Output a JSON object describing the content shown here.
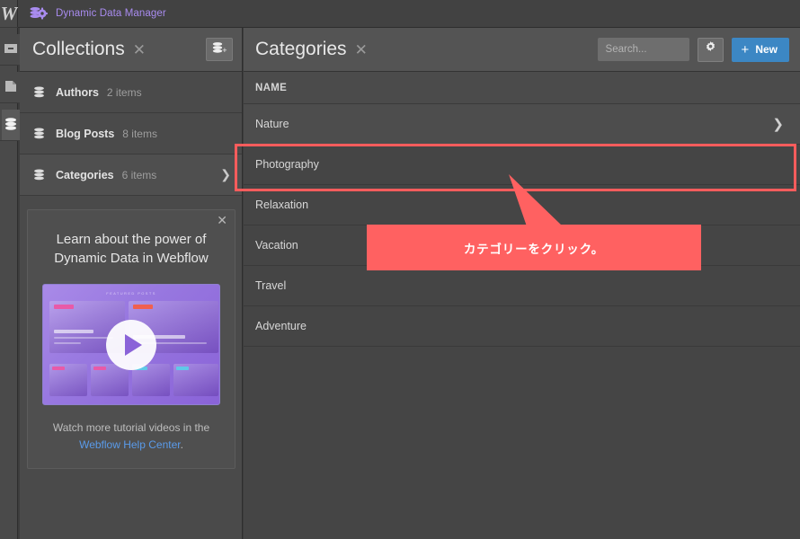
{
  "window": {
    "app_logo": "webflow-w-logo",
    "title": "Dynamic Data Manager",
    "title_icon": "database-gear-icon",
    "accent_purple": "#a98cf0",
    "accent_blue": "#3c87c4",
    "annotation_red": "#ff6161"
  },
  "left_rail": {
    "items": [
      {
        "icon": "add-element-icon"
      },
      {
        "icon": "pages-icon"
      },
      {
        "icon": "cms-database-icon",
        "active": true
      }
    ]
  },
  "collections_panel": {
    "title": "Collections",
    "close_icon": "close-icon",
    "add_button_icon": "add-collection-icon",
    "items": [
      {
        "name": "Authors",
        "count": "2 items",
        "icon": "database-icon",
        "selected": false,
        "chevron": false
      },
      {
        "name": "Blog Posts",
        "count": "8 items",
        "icon": "database-icon",
        "selected": false,
        "chevron": false
      },
      {
        "name": "Categories",
        "count": "6 items",
        "icon": "database-icon",
        "selected": true,
        "chevron": true
      }
    ]
  },
  "promo_card": {
    "close_icon": "close-icon",
    "heading_line1": "Learn about the power of",
    "heading_line2": "Dynamic Data in Webflow",
    "thumbnail_label": "FEATURED POSTS",
    "play_icon": "play-icon",
    "footer_text": "Watch more tutorial videos in the",
    "footer_link": "Webflow Help Center",
    "footer_period": "."
  },
  "categories_panel": {
    "title": "Categories",
    "close_icon": "close-icon",
    "search_placeholder": "Search...",
    "search_value": "",
    "settings_icon": "gear-icon",
    "new_button_label": "New",
    "new_button_icon": "plus-icon",
    "column_header": "NAME",
    "rows": [
      {
        "name": "Nature",
        "hover": true,
        "chevron": true
      },
      {
        "name": "Photography",
        "hover": false,
        "chevron": false
      },
      {
        "name": "Relaxation",
        "hover": false,
        "chevron": false
      },
      {
        "name": "Vacation",
        "hover": false,
        "chevron": false
      },
      {
        "name": "Travel",
        "hover": false,
        "chevron": false
      },
      {
        "name": "Adventure",
        "hover": false,
        "chevron": false
      }
    ]
  },
  "annotation": {
    "callout_text": "カテゴリーをクリック。",
    "highlight_target": "Photography"
  }
}
